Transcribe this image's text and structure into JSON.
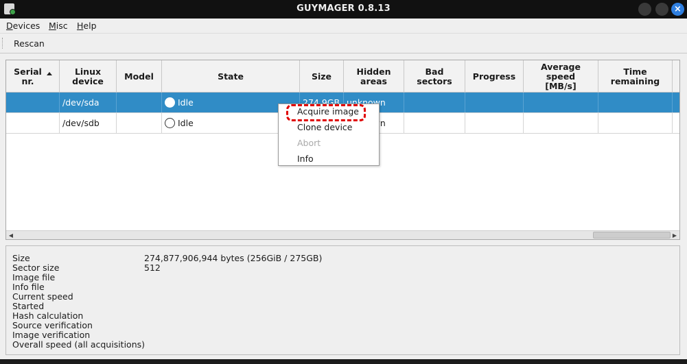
{
  "window": {
    "title": "GUYMAGER 0.8.13",
    "close_glyph": "×"
  },
  "menubar": {
    "items": [
      "Devices",
      "Misc",
      "Help"
    ]
  },
  "toolbar": {
    "rescan_label": "Rescan"
  },
  "table": {
    "columns": [
      "Serial\nnr.",
      "Linux\ndevice",
      "Model",
      "State",
      "Size",
      "Hidden\nareas",
      "Bad\nsectors",
      "Progress",
      "Average\nspeed\n[MB/s]",
      "Time\nremaining"
    ],
    "sorted_column": "Serial\nnr.",
    "rows": [
      {
        "serial": "",
        "device": "/dev/sda",
        "model": "",
        "state": "Idle",
        "size": "274.9GB",
        "hidden": "unknown",
        "bad": "",
        "progress": "",
        "speed": "",
        "time": "",
        "selected": true
      },
      {
        "serial": "",
        "device": "/dev/sdb",
        "model": "",
        "state": "Idle",
        "size": "",
        "hidden": "unknown",
        "bad": "",
        "progress": "",
        "speed": "",
        "time": "",
        "selected": false
      }
    ]
  },
  "context_menu": {
    "items": [
      {
        "label": "Acquire image",
        "enabled": true
      },
      {
        "label": "Clone device",
        "enabled": true
      },
      {
        "label": "Abort",
        "enabled": false
      },
      {
        "label": "Info",
        "enabled": true
      }
    ],
    "highlighted": "Acquire image",
    "highlight_color": "#e00000"
  },
  "details": {
    "labels": [
      "Size",
      "Sector size",
      "Image file",
      "Info file",
      "Current speed",
      "Started",
      "Hash calculation",
      "Source verification",
      "Image verification",
      "Overall speed (all acquisitions)"
    ],
    "values": [
      "274,877,906,944 bytes (256GiB / 275GB)",
      "512",
      "",
      "",
      "",
      "",
      "",
      "",
      "",
      ""
    ]
  },
  "colors": {
    "selection": "#308cc6",
    "titlebar": "#111111",
    "close_button": "#2f7fe0"
  }
}
